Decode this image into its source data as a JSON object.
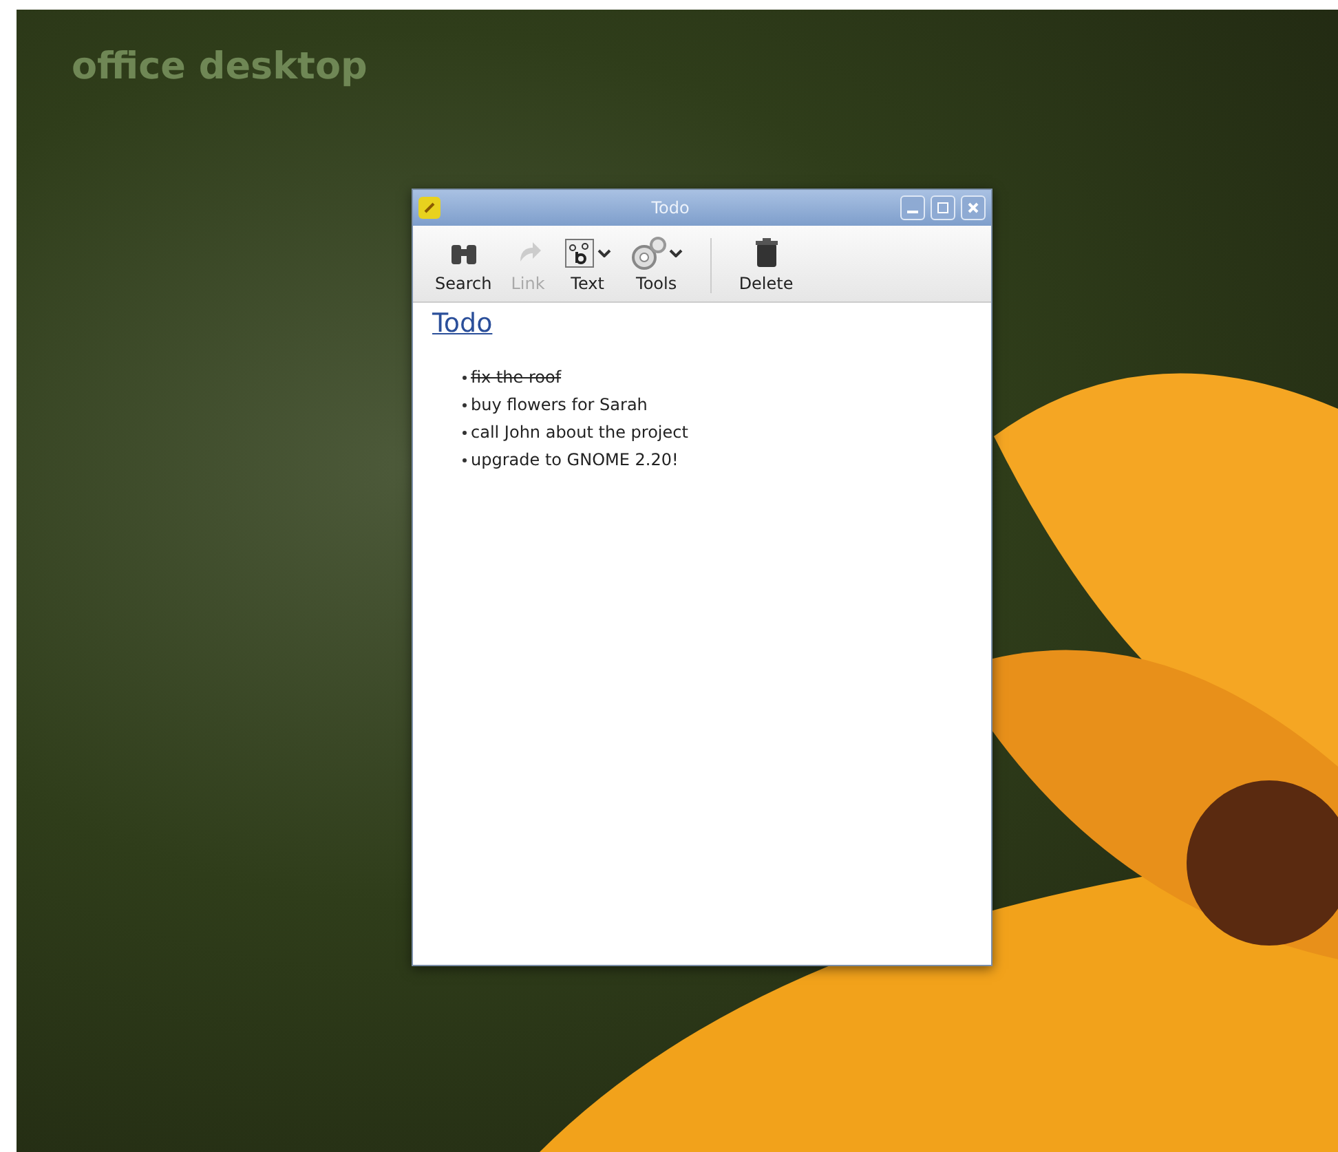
{
  "desktop": {
    "label": "office desktop"
  },
  "window": {
    "title": "Todo",
    "toolbar": [
      {
        "kind": "search",
        "label": "Search",
        "disabled": false,
        "dropdown": false
      },
      {
        "kind": "link",
        "label": "Link",
        "disabled": true,
        "dropdown": false
      },
      {
        "kind": "text",
        "label": "Text",
        "disabled": false,
        "dropdown": true
      },
      {
        "kind": "tools",
        "label": "Tools",
        "disabled": false,
        "dropdown": true
      },
      {
        "kind": "separator"
      },
      {
        "kind": "delete",
        "label": "Delete",
        "disabled": false,
        "dropdown": false
      }
    ],
    "note": {
      "title": "Todo",
      "items": [
        {
          "text": "fix the roof",
          "done": true
        },
        {
          "text": "buy flowers for Sarah",
          "done": false
        },
        {
          "text": "call John about the project",
          "done": false
        },
        {
          "text": "upgrade to GNOME 2.20!",
          "done": false
        }
      ]
    }
  }
}
